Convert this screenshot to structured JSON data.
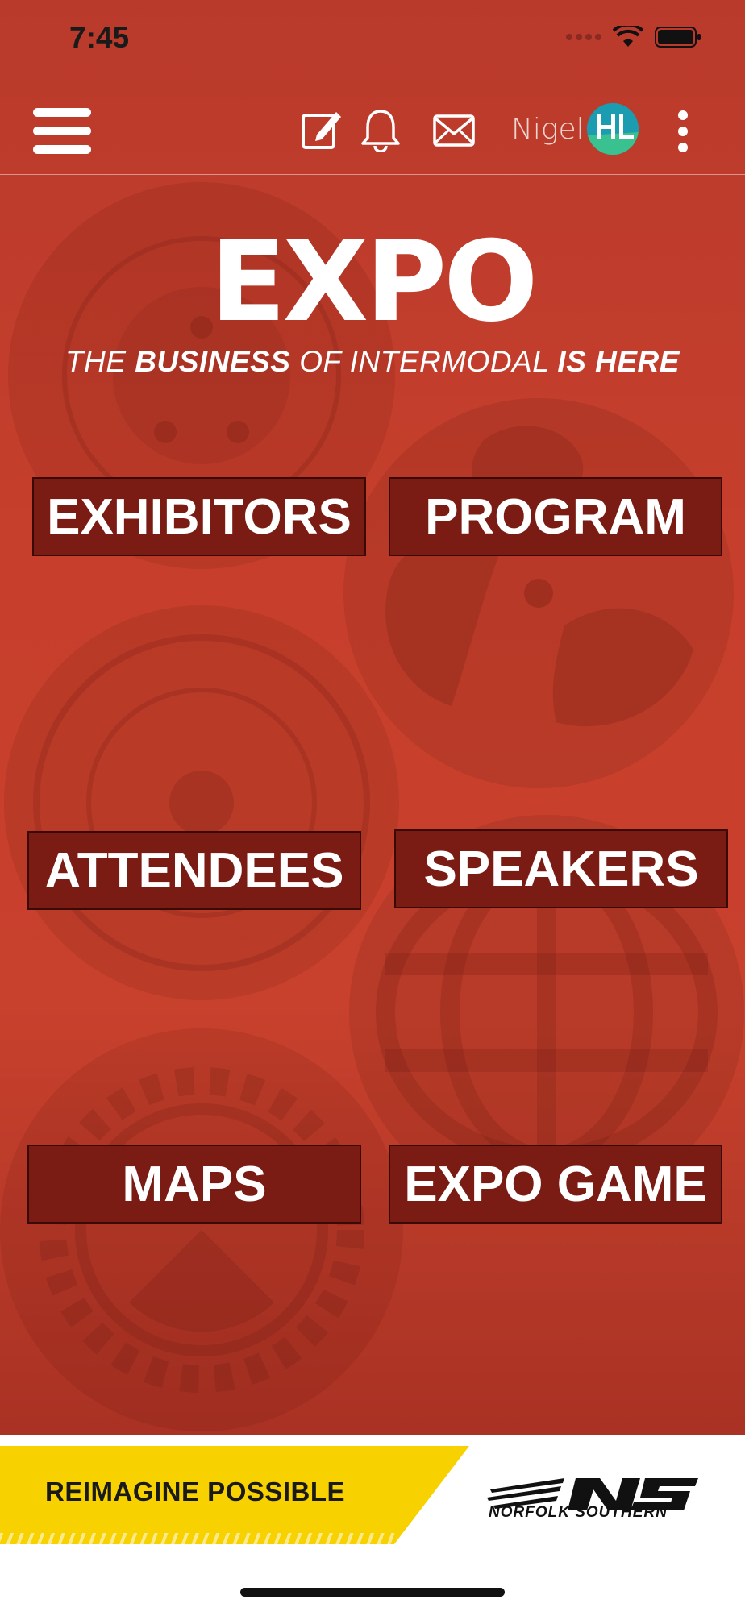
{
  "status_bar": {
    "time": "7:45"
  },
  "top_bar": {
    "username": "Nigel",
    "avatar_initials": "HL",
    "icons": [
      "menu-icon",
      "edit-icon",
      "bell-icon",
      "mail-icon",
      "more-icon"
    ]
  },
  "hero": {
    "logo": "EXPO",
    "tagline_parts": [
      "THE ",
      "BUSINESS",
      " OF INTERMODAL ",
      "IS HERE"
    ]
  },
  "tiles": [
    "EXHIBITORS",
    "PROGRAM",
    "ATTENDEES",
    "SPEAKERS",
    "MAPS",
    "EXPO GAME"
  ],
  "banner": {
    "slogan": "REIMAGINE POSSIBLE",
    "brand": "NORFOLK SOUTHERN",
    "brand_mark": "NS"
  },
  "colors": {
    "background": "#c73f2c",
    "tile": "#7a1c14",
    "banner_yellow": "#f7d100",
    "avatar": "#1b9cb0"
  }
}
